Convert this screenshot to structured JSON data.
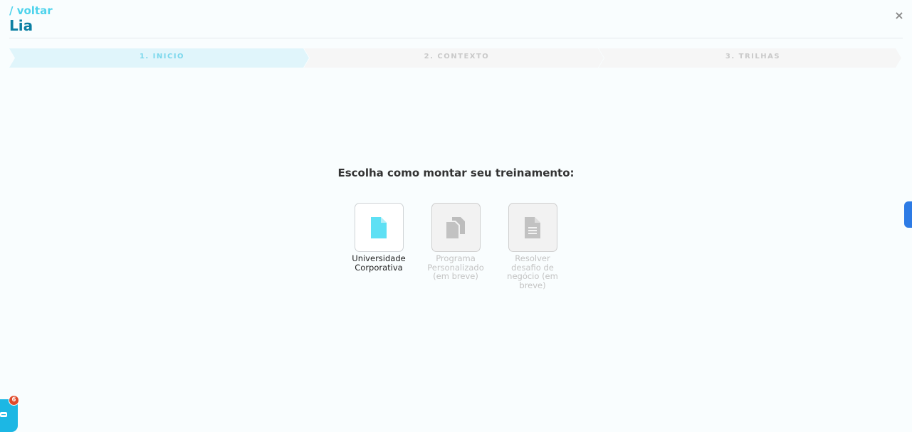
{
  "header": {
    "back_label": "/ voltar",
    "title": "Lia",
    "close_label": "×"
  },
  "stepper": {
    "steps": [
      {
        "label": "1. INICIO",
        "active": true
      },
      {
        "label": "2. CONTEXTO",
        "active": false
      },
      {
        "label": "3. TRILHAS",
        "active": false
      }
    ]
  },
  "main": {
    "prompt": "Escolha como montar seu treinamento:",
    "options": [
      {
        "label": "Universidade Corporativa",
        "icon": "document-icon",
        "enabled": true
      },
      {
        "label": "Programa Personalizado (em breve)",
        "icon": "copy-documents-icon",
        "enabled": false
      },
      {
        "label": "Resolver desafio de negócio (em breve)",
        "icon": "text-document-icon",
        "enabled": false
      }
    ]
  },
  "chat": {
    "badge_count": "6"
  },
  "colors": {
    "accent": "#4ed3ec",
    "title": "#0b7fa3",
    "active_step_bg": "#e0f5fb",
    "inactive_step_bg": "#f6f6f6",
    "side_tab": "#2d7be5",
    "chat_button": "#1cb7e4",
    "badge": "#e04b2c"
  }
}
